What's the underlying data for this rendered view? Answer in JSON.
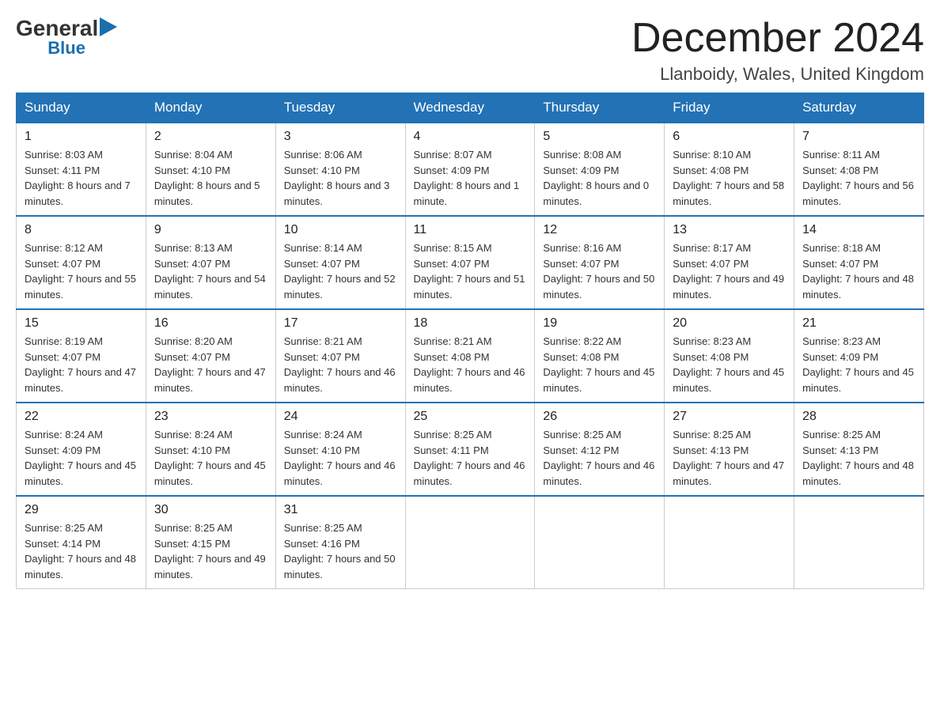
{
  "header": {
    "logo": {
      "general": "General",
      "blue": "Blue"
    },
    "title": "December 2024",
    "subtitle": "Llanboidy, Wales, United Kingdom"
  },
  "days_of_week": [
    "Sunday",
    "Monday",
    "Tuesday",
    "Wednesday",
    "Thursday",
    "Friday",
    "Saturday"
  ],
  "weeks": [
    [
      {
        "day": 1,
        "sunrise": "8:03 AM",
        "sunset": "4:11 PM",
        "daylight": "8 hours and 7 minutes."
      },
      {
        "day": 2,
        "sunrise": "8:04 AM",
        "sunset": "4:10 PM",
        "daylight": "8 hours and 5 minutes."
      },
      {
        "day": 3,
        "sunrise": "8:06 AM",
        "sunset": "4:10 PM",
        "daylight": "8 hours and 3 minutes."
      },
      {
        "day": 4,
        "sunrise": "8:07 AM",
        "sunset": "4:09 PM",
        "daylight": "8 hours and 1 minute."
      },
      {
        "day": 5,
        "sunrise": "8:08 AM",
        "sunset": "4:09 PM",
        "daylight": "8 hours and 0 minutes."
      },
      {
        "day": 6,
        "sunrise": "8:10 AM",
        "sunset": "4:08 PM",
        "daylight": "7 hours and 58 minutes."
      },
      {
        "day": 7,
        "sunrise": "8:11 AM",
        "sunset": "4:08 PM",
        "daylight": "7 hours and 56 minutes."
      }
    ],
    [
      {
        "day": 8,
        "sunrise": "8:12 AM",
        "sunset": "4:07 PM",
        "daylight": "7 hours and 55 minutes."
      },
      {
        "day": 9,
        "sunrise": "8:13 AM",
        "sunset": "4:07 PM",
        "daylight": "7 hours and 54 minutes."
      },
      {
        "day": 10,
        "sunrise": "8:14 AM",
        "sunset": "4:07 PM",
        "daylight": "7 hours and 52 minutes."
      },
      {
        "day": 11,
        "sunrise": "8:15 AM",
        "sunset": "4:07 PM",
        "daylight": "7 hours and 51 minutes."
      },
      {
        "day": 12,
        "sunrise": "8:16 AM",
        "sunset": "4:07 PM",
        "daylight": "7 hours and 50 minutes."
      },
      {
        "day": 13,
        "sunrise": "8:17 AM",
        "sunset": "4:07 PM",
        "daylight": "7 hours and 49 minutes."
      },
      {
        "day": 14,
        "sunrise": "8:18 AM",
        "sunset": "4:07 PM",
        "daylight": "7 hours and 48 minutes."
      }
    ],
    [
      {
        "day": 15,
        "sunrise": "8:19 AM",
        "sunset": "4:07 PM",
        "daylight": "7 hours and 47 minutes."
      },
      {
        "day": 16,
        "sunrise": "8:20 AM",
        "sunset": "4:07 PM",
        "daylight": "7 hours and 47 minutes."
      },
      {
        "day": 17,
        "sunrise": "8:21 AM",
        "sunset": "4:07 PM",
        "daylight": "7 hours and 46 minutes."
      },
      {
        "day": 18,
        "sunrise": "8:21 AM",
        "sunset": "4:08 PM",
        "daylight": "7 hours and 46 minutes."
      },
      {
        "day": 19,
        "sunrise": "8:22 AM",
        "sunset": "4:08 PM",
        "daylight": "7 hours and 45 minutes."
      },
      {
        "day": 20,
        "sunrise": "8:23 AM",
        "sunset": "4:08 PM",
        "daylight": "7 hours and 45 minutes."
      },
      {
        "day": 21,
        "sunrise": "8:23 AM",
        "sunset": "4:09 PM",
        "daylight": "7 hours and 45 minutes."
      }
    ],
    [
      {
        "day": 22,
        "sunrise": "8:24 AM",
        "sunset": "4:09 PM",
        "daylight": "7 hours and 45 minutes."
      },
      {
        "day": 23,
        "sunrise": "8:24 AM",
        "sunset": "4:10 PM",
        "daylight": "7 hours and 45 minutes."
      },
      {
        "day": 24,
        "sunrise": "8:24 AM",
        "sunset": "4:10 PM",
        "daylight": "7 hours and 46 minutes."
      },
      {
        "day": 25,
        "sunrise": "8:25 AM",
        "sunset": "4:11 PM",
        "daylight": "7 hours and 46 minutes."
      },
      {
        "day": 26,
        "sunrise": "8:25 AM",
        "sunset": "4:12 PM",
        "daylight": "7 hours and 46 minutes."
      },
      {
        "day": 27,
        "sunrise": "8:25 AM",
        "sunset": "4:13 PM",
        "daylight": "7 hours and 47 minutes."
      },
      {
        "day": 28,
        "sunrise": "8:25 AM",
        "sunset": "4:13 PM",
        "daylight": "7 hours and 48 minutes."
      }
    ],
    [
      {
        "day": 29,
        "sunrise": "8:25 AM",
        "sunset": "4:14 PM",
        "daylight": "7 hours and 48 minutes."
      },
      {
        "day": 30,
        "sunrise": "8:25 AM",
        "sunset": "4:15 PM",
        "daylight": "7 hours and 49 minutes."
      },
      {
        "day": 31,
        "sunrise": "8:25 AM",
        "sunset": "4:16 PM",
        "daylight": "7 hours and 50 minutes."
      },
      null,
      null,
      null,
      null
    ]
  ]
}
